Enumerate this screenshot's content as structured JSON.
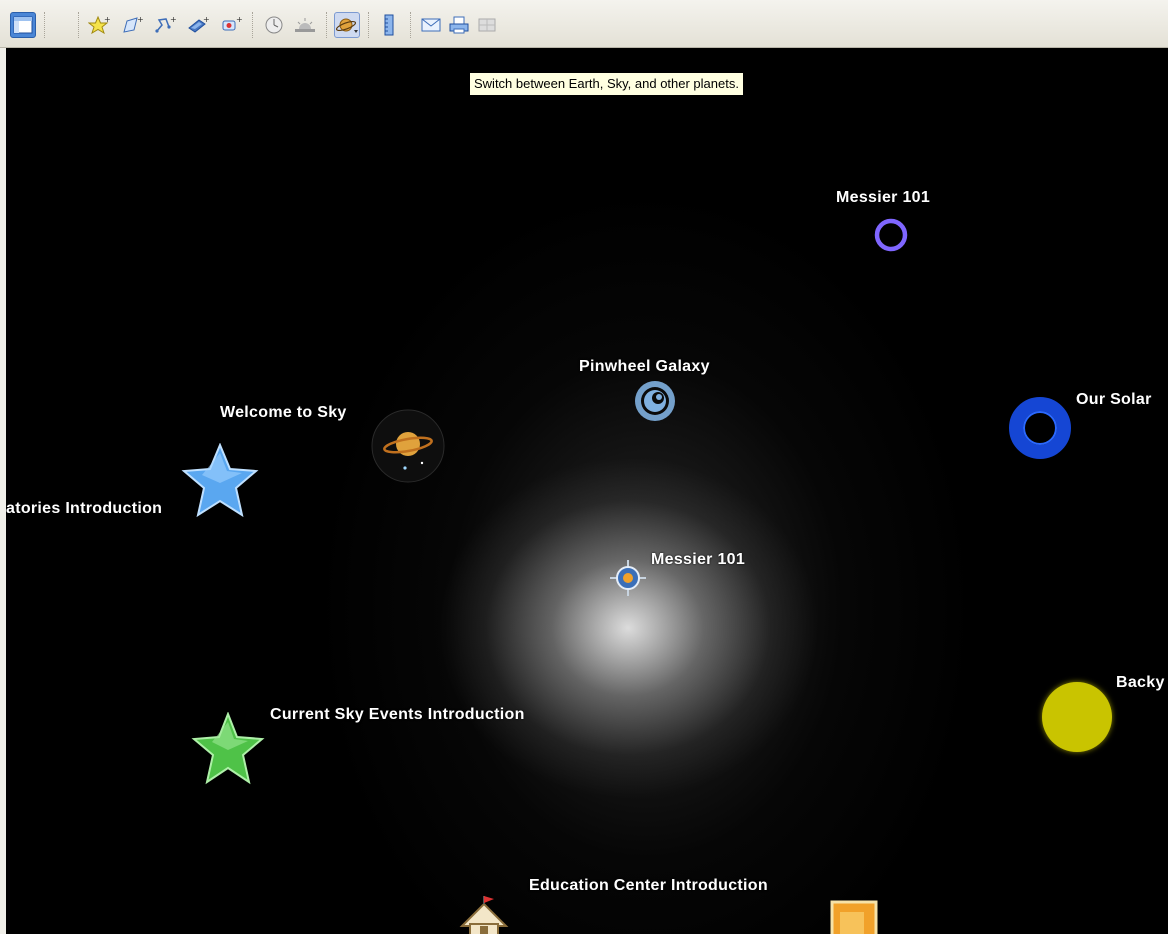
{
  "toolbar": {
    "buttons": [
      {
        "name": "sidebar-toggle-button",
        "icon": "sidebar-icon",
        "selected": true
      },
      {
        "name": "add-placemark-button",
        "icon": "placemark-pushpin-icon"
      },
      {
        "name": "add-polygon-button",
        "icon": "polygon-icon"
      },
      {
        "name": "add-path-button",
        "icon": "path-icon"
      },
      {
        "name": "add-image-overlay-button",
        "icon": "image-overlay-icon"
      },
      {
        "name": "record-tour-button",
        "icon": "record-tour-icon"
      },
      {
        "name": "historical-imagery-button",
        "icon": "clock-icon"
      },
      {
        "name": "sunlight-button",
        "icon": "sunlight-icon"
      },
      {
        "name": "switch-planet-button",
        "icon": "planet-icon",
        "active": true
      },
      {
        "name": "ruler-button",
        "icon": "ruler-icon"
      },
      {
        "name": "email-button",
        "icon": "email-icon"
      },
      {
        "name": "print-button",
        "icon": "print-icon"
      },
      {
        "name": "view-in-maps-button",
        "icon": "maps-icon"
      }
    ],
    "tooltip": "Switch between Earth, Sky, and other planets."
  },
  "sky": {
    "labels": {
      "messier_top": "Messier 101",
      "pinwheel": "Pinwheel Galaxy",
      "our_solar": "Our Solar",
      "welcome": "Welcome to Sky",
      "observatories": "atories Introduction",
      "messier_center": "Messier 101",
      "backyard": "Backy",
      "current_events": "Current Sky Events Introduction",
      "education": "Education Center Introduction"
    },
    "colors": {
      "messier_ring": "#7f66ff",
      "solar_ring": "#1546d4",
      "backyard_disc": "#c9c400",
      "blue_star": "#5aa7f0",
      "green_star": "#4fc248",
      "pinwheel_icon": "#7fb0e0"
    }
  }
}
